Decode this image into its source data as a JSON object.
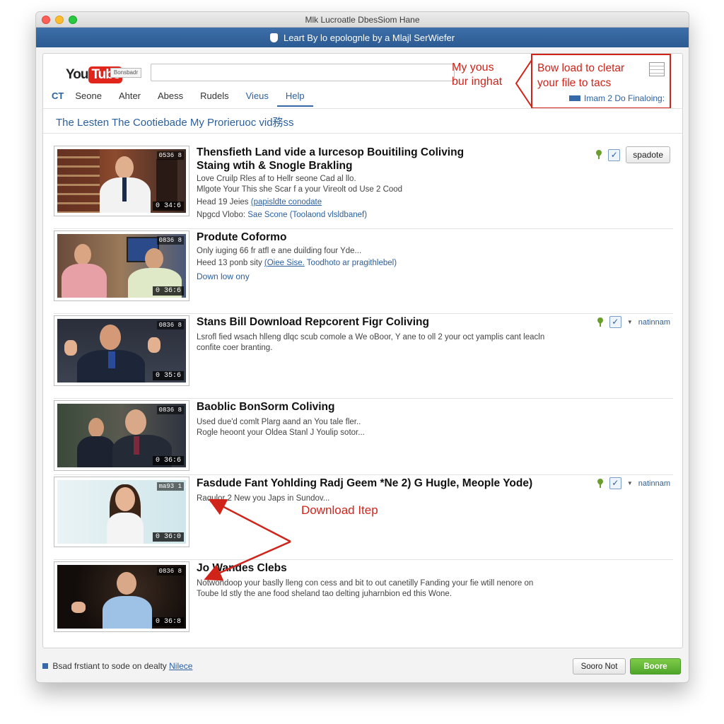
{
  "window": {
    "title": "Mlk Lucroatle DbesSiom Hane"
  },
  "banner": {
    "text": "Leart By lo epolognle by a Mlajl SerWiefer"
  },
  "header": {
    "logo_you": "You",
    "logo_tube": "Tube",
    "logo_badge": "Bonsbadr",
    "search_value": "",
    "search_hint_line1": "My yous",
    "search_hint_line2": "bur inghat",
    "callout_line1": "Bow load to cletar",
    "callout_line2": "your file to tacs",
    "callout_sub": "Imam 2 Do Finaloing:"
  },
  "nav": {
    "prefix": "CT",
    "items": [
      {
        "label": "Seone"
      },
      {
        "label": "Ahter"
      },
      {
        "label": "Abess"
      },
      {
        "label": "Rudels"
      },
      {
        "label": "Vieus"
      },
      {
        "label": "Help"
      }
    ]
  },
  "section": {
    "title": "The Lesten The Cootiebade My Prorieruoc vid務ss"
  },
  "videos": [
    {
      "title_line1": "Thensfieth Land vide a Iurcesop Bouitiling Coliving",
      "title_line2": "Staing wtih & Snogle Brakling",
      "desc_line1": "Love Cruilp Rles af to Hellr seone Cad al llo.",
      "desc_line2": "Mlgote Your This she Scar f a your Vireolt od Use 2 Cood",
      "meta1_label": "Head 19 Jeies",
      "meta1_link": "(papisldte conodate",
      "meta2_label": "Npgcd Vlobo:",
      "meta2_link": "Sae Scone (Toolaond vlsldbanef)",
      "duration": "0 34:6",
      "badge": "0536 8",
      "action_button": "spadote"
    },
    {
      "title_line1": "Produte Coformo",
      "desc_line1": "Only iuging 66 fr atfl e ane duilding four Yde...",
      "meta1_label": "Heed 13 ponb sity",
      "meta1_link": "(Oiee Sise.",
      "meta1_link2": "Toodhoto ar pragithlebel)",
      "link": "Down low ony",
      "duration": "0 36:6",
      "badge": "0836 8"
    },
    {
      "title_line1": "Stans Bill Download Repcorent Figr Coliving",
      "desc_line1": "Lsrofl fied wsach hlleng dlqc scub comole a We oBoor, Y ane to oll 2 your oct yamplis cant leacln",
      "desc_line2": "confite coer branting.",
      "duration": "0 35:6",
      "badge": "0836 8",
      "action_link": "natinnam"
    },
    {
      "title_line1": "Baoblic BonSorm Coliving",
      "desc_line1": "Used due'd comlt Plarg aand an You tale fler..",
      "desc_line2": "Rogle heoont your Oldea Stanl J Youlip sotor...",
      "duration": "0 36:6",
      "badge": "0836 8"
    },
    {
      "title_line1": "Fasdude Fant Yohlding Radj Geem *Ne 2) G Hugle, Meople Yode)",
      "desc_line1": "Raqulor 2 New you Japs in Sundov...",
      "duration": "0 36:0",
      "badge": "ma93 1",
      "action_link": "natinnam"
    },
    {
      "title_line1": "Jo Wandes Clebs",
      "desc_line1": "Notwondoop your baslly lleng con cess and bit to out canetilly Fanding your fie wtill nenore on",
      "desc_line2": "Toube ld stly the ane food sheland tao delting juharnbion ed this Wone.",
      "duration": "0 36:8",
      "badge": "0836 8"
    }
  ],
  "annotation": {
    "label": "Download Itep"
  },
  "footer": {
    "text": "Bsad frstiant to sode on dealty",
    "link": "Nilece",
    "cancel_label": "Sooro Not",
    "confirm_label": "Boore"
  },
  "colors": {
    "brand_blue": "#2b5f9e",
    "annotation_red": "#d0241a",
    "youtube_red": "#e1251b",
    "confirm_green": "#4fa52a"
  }
}
